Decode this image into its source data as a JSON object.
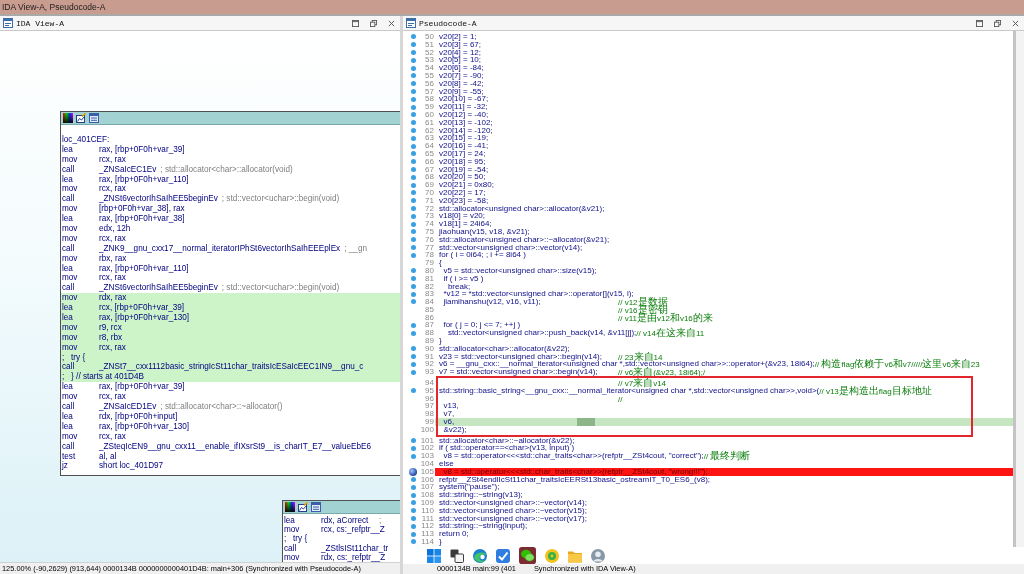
{
  "window": {
    "title": "IDA View-A, Pseudocode-A"
  },
  "ida_view": {
    "title": "IDA View-A",
    "nodes": [
      {
        "lines": [
          {
            "kind": "label",
            "text": "loc_401CEF:",
            "highlighted": false
          },
          {
            "kind": "instruction",
            "mnemonic": "lea",
            "operands": "rax, [rbp+0F0h+var_39]",
            "highlighted": false
          },
          {
            "kind": "instruction",
            "mnemonic": "mov",
            "operands": "rcx, rax",
            "highlighted": false
          },
          {
            "kind": "instruction",
            "mnemonic": "call",
            "operands": "_ZNSaIcEC1Ev",
            "comment": "; std::allocator<char>::allocator(void)",
            "highlighted": false
          },
          {
            "kind": "instruction",
            "mnemonic": "lea",
            "operands": "rax, [rbp+0F0h+var_110]",
            "highlighted": false
          },
          {
            "kind": "instruction",
            "mnemonic": "mov",
            "operands": "rcx, rax",
            "highlighted": false
          },
          {
            "kind": "instruction",
            "mnemonic": "call",
            "operands": "_ZNSt6vectorIhSaIhEE5beginEv",
            "comment": "; std::vector<uchar>::begin(void)",
            "highlighted": false
          },
          {
            "kind": "instruction",
            "mnemonic": "mov",
            "operands": "[rbp+0F0h+var_38], rax",
            "highlighted": false
          },
          {
            "kind": "instruction",
            "mnemonic": "lea",
            "operands": "rax, [rbp+0F0h+var_38]",
            "highlighted": false
          },
          {
            "kind": "instruction",
            "mnemonic": "mov",
            "operands": "edx, 12h",
            "highlighted": false
          },
          {
            "kind": "instruction",
            "mnemonic": "mov",
            "operands": "rcx, rax",
            "highlighted": false
          },
          {
            "kind": "instruction",
            "mnemonic": "call",
            "operands": "_ZNK9__gnu_cxx17__normal_iteratorIPhSt6vectorIhSaIhEEEplEx",
            "comment": "; __gn",
            "highlighted": false
          },
          {
            "kind": "instruction",
            "mnemonic": "mov",
            "operands": "rbx, rax",
            "highlighted": false
          },
          {
            "kind": "instruction",
            "mnemonic": "lea",
            "operands": "rax, [rbp+0F0h+var_110]",
            "highlighted": false
          },
          {
            "kind": "instruction",
            "mnemonic": "mov",
            "operands": "rcx, rax",
            "highlighted": false
          },
          {
            "kind": "instruction",
            "mnemonic": "call",
            "operands": "_ZNSt6vectorIhSaIhEE5beginEv",
            "comment": "; std::vector<uchar>::begin(void)",
            "highlighted": false
          },
          {
            "kind": "instruction",
            "mnemonic": "mov",
            "operands": "rdx, rax",
            "highlighted": true
          },
          {
            "kind": "instruction",
            "mnemonic": "lea",
            "operands": "rcx, [rbp+0F0h+var_39]",
            "highlighted": true
          },
          {
            "kind": "instruction",
            "mnemonic": "lea",
            "operands": "rax, [rbp+0F0h+var_130]",
            "highlighted": true
          },
          {
            "kind": "instruction",
            "mnemonic": "mov",
            "operands": "r9, rcx",
            "highlighted": true
          },
          {
            "kind": "instruction",
            "mnemonic": "mov",
            "operands": "r8, rbx",
            "highlighted": true
          },
          {
            "kind": "instruction",
            "mnemonic": "mov",
            "operands": "rcx, rax",
            "highlighted": true
          },
          {
            "kind": "directive",
            "text": ";   try {",
            "highlighted": true
          },
          {
            "kind": "instruction",
            "mnemonic": "call",
            "operands": "_ZNSt7__cxx1112basic_stringIcSt11char_traitsIcESaIcEEC1IN9__gnu_c",
            "highlighted": true
          },
          {
            "kind": "directive",
            "text": ";   } // starts at 401D4B",
            "highlighted": true
          },
          {
            "kind": "instruction",
            "mnemonic": "lea",
            "operands": "rax, [rbp+0F0h+var_39]",
            "highlighted": false
          },
          {
            "kind": "instruction",
            "mnemonic": "mov",
            "operands": "rcx, rax",
            "highlighted": false
          },
          {
            "kind": "instruction",
            "mnemonic": "call",
            "operands": "_ZNSaIcED1Ev",
            "comment": "; std::allocator<char>::~allocator()",
            "highlighted": false
          },
          {
            "kind": "instruction",
            "mnemonic": "lea",
            "operands": "rdx, [rbp+0F0h+input]",
            "highlighted": false
          },
          {
            "kind": "instruction",
            "mnemonic": "lea",
            "operands": "rax, [rbp+0F0h+var_130]",
            "highlighted": false
          },
          {
            "kind": "instruction",
            "mnemonic": "mov",
            "operands": "rcx, rax",
            "highlighted": false
          },
          {
            "kind": "instruction",
            "mnemonic": "call",
            "operands": "_ZSteqIcEN9__gnu_cxx11__enable_ifIXsrSt9__is_charIT_E7__valueEbE6",
            "highlighted": false
          },
          {
            "kind": "instruction",
            "mnemonic": "test",
            "operands": "al, al",
            "highlighted": false
          },
          {
            "kind": "instruction",
            "mnemonic": "jz",
            "operands": "short loc_401D97",
            "highlighted": false
          }
        ]
      },
      {
        "lines": [
          {
            "kind": "instruction",
            "mnemonic": "lea",
            "operands": "rdx, aCorrect",
            "comment": ";",
            "highlighted": false
          },
          {
            "kind": "instruction",
            "mnemonic": "mov",
            "operands": "rcx, cs:_refptr__Z",
            "highlighted": false
          },
          {
            "kind": "directive",
            "text": ";   try {",
            "highlighted": false
          },
          {
            "kind": "instruction",
            "mnemonic": "call",
            "operands": "_ZStlsISt11char_tr",
            "highlighted": false
          },
          {
            "kind": "instruction",
            "mnemonic": "mov",
            "operands": "rdx, cs:_refptr__Z",
            "highlighted": false
          }
        ]
      }
    ],
    "status_bar": "125.00% (-90,2629) (913,644) 0000134B 0000000000401D4B: main+306 (Synchronized with Pseudocode-A)"
  },
  "pseudocode": {
    "title": "Pseudocode-A",
    "blocks": [
      {
        "kind": "plain",
        "lines": [
          {
            "number": "50",
            "code": "v20[2] = 1;",
            "dot": true,
            "selected": false,
            "breakpoint": false
          },
          {
            "number": "51",
            "code": "v20[3] = 67;",
            "dot": true,
            "selected": false,
            "breakpoint": false
          },
          {
            "number": "52",
            "code": "v20[4] = 12;",
            "dot": true,
            "selected": false,
            "breakpoint": false
          },
          {
            "number": "53",
            "code": "v20[5] = 10;",
            "dot": true,
            "selected": false,
            "breakpoint": false
          },
          {
            "number": "54",
            "code": "v20[6] = -84;",
            "dot": true,
            "selected": false,
            "breakpoint": false
          },
          {
            "number": "55",
            "code": "v20[7] = -90;",
            "dot": true,
            "selected": false,
            "breakpoint": false
          },
          {
            "number": "56",
            "code": "v20[8] = -42;",
            "dot": true,
            "selected": false,
            "breakpoint": false
          },
          {
            "number": "57",
            "code": "v20[9] = -55;",
            "dot": true,
            "selected": false,
            "breakpoint": false
          },
          {
            "number": "58",
            "code": "v20[10] = -67;",
            "dot": true,
            "selected": false,
            "breakpoint": false
          },
          {
            "number": "59",
            "code": "v20[11] = -32;",
            "dot": true,
            "selected": false,
            "breakpoint": false
          },
          {
            "number": "60",
            "code": "v20[12] = -40;",
            "dot": true,
            "selected": false,
            "breakpoint": false
          },
          {
            "number": "61",
            "code": "v20[13] = -102;",
            "dot": true,
            "selected": false,
            "breakpoint": false
          },
          {
            "number": "62",
            "code": "v20[14] = -120;",
            "dot": true,
            "selected": false,
            "breakpoint": false
          },
          {
            "number": "63",
            "code": "v20[15] = -19;",
            "dot": true,
            "selected": false,
            "breakpoint": false
          },
          {
            "number": "64",
            "code": "v20[16] = -41;",
            "dot": true,
            "selected": false,
            "breakpoint": false
          },
          {
            "number": "65",
            "code": "v20[17] = 24;",
            "dot": true,
            "selected": false,
            "breakpoint": false
          },
          {
            "number": "66",
            "code": "v20[18] = 95;",
            "dot": true,
            "selected": false,
            "breakpoint": false
          },
          {
            "number": "67",
            "code": "v20[19] = -54;",
            "dot": true,
            "selected": false,
            "breakpoint": false
          },
          {
            "number": "68",
            "code": "v20[20] = 50;",
            "dot": true,
            "selected": false,
            "breakpoint": false
          },
          {
            "number": "69",
            "code": "v20[21] = 0x80;",
            "dot": true,
            "selected": false,
            "breakpoint": false
          },
          {
            "number": "70",
            "code": "v20[22] = 17;",
            "dot": true,
            "selected": false,
            "breakpoint": false
          },
          {
            "number": "71",
            "code": "v20[23] = -58;",
            "dot": true,
            "selected": false,
            "breakpoint": false
          },
          {
            "number": "72",
            "code": "std::allocator<unsigned char>::allocator(&v21);",
            "dot": true,
            "selected": false,
            "breakpoint": false
          },
          {
            "number": "73",
            "code": "v18[0] = v20;",
            "dot": true,
            "selected": false,
            "breakpoint": false
          },
          {
            "number": "74",
            "code": "v18[1] = 24i64;",
            "dot": true,
            "selected": false,
            "breakpoint": false
          },
          {
            "number": "75",
            "code": "jiaohuan(v15, v18, &v21);",
            "dot": true,
            "selected": false,
            "breakpoint": false
          },
          {
            "number": "76",
            "code": "std::allocator<unsigned char>::~allocator(&v21);",
            "dot": true,
            "selected": false,
            "breakpoint": false
          },
          {
            "number": "77",
            "code": "std::vector<unsigned char>::vector(v14);",
            "dot": true,
            "selected": false,
            "breakpoint": false
          },
          {
            "number": "78",
            "code": "for ( i = 0i64; ; i += 8i64 )",
            "dot": true,
            "selected": false,
            "breakpoint": false
          },
          {
            "number": "79",
            "code": "{",
            "dot": false,
            "selected": false,
            "breakpoint": false
          },
          {
            "number": "80",
            "code": "  v5 = std::vector<unsigned char>::size(v15);",
            "dot": true,
            "selected": false,
            "breakpoint": false
          },
          {
            "number": "81",
            "code": "  if ( i >= v5 )",
            "dot": true,
            "selected": false,
            "breakpoint": false
          },
          {
            "number": "82",
            "code": "    break;",
            "dot": true,
            "selected": false,
            "breakpoint": false
          },
          {
            "number": "83",
            "code": "  *v12 = *std::vector<unsigned char>::operator[](v15, i);",
            "dot": true,
            "selected": false,
            "breakpoint": false
          },
          {
            "number": "84",
            "code": "  jiamihanshu(v12, v16, v11);",
            "comment": "// v12是数据",
            "dot": true,
            "selected": false,
            "breakpoint": false
          },
          {
            "number": "85",
            "comment": "// v16是密钥",
            "dot": false,
            "selected": false,
            "breakpoint": false
          },
          {
            "number": "86",
            "comment": "// v11是由v12和v16的来",
            "dot": false,
            "selected": false,
            "breakpoint": false
          },
          {
            "number": "87",
            "code": "  for ( j = 0; j <= 7; ++j )",
            "dot": true,
            "selected": false,
            "breakpoint": false
          },
          {
            "number": "88",
            "code": "    std::vector<unsigned char>::push_back(v14, &v11[j]);",
            "comment": "// v14在这来自11",
            "dot": true,
            "selected": false,
            "breakpoint": false
          },
          {
            "number": "89",
            "code": "}",
            "dot": false,
            "selected": false,
            "breakpoint": false
          },
          {
            "number": "90",
            "code": "std::allocator<char>::allocator(&v22);",
            "dot": true,
            "selected": false,
            "breakpoint": false
          },
          {
            "number": "91",
            "code": "v23 = std::vector<unsigned char>::begin(v14);",
            "comment": "// 23来自14",
            "dot": true,
            "selected": false,
            "breakpoint": false
          },
          {
            "number": "92",
            "code": "v6 = __gnu_cxx::__normal_iterator<unsigned char *,std::vector<unsigned char>>::operator+(&v23, 18i64);",
            "comment": "// 构造flag依赖于v6和v7/////这里v6来自23",
            "dot": true,
            "selected": false,
            "breakpoint": false
          },
          {
            "number": "93",
            "code": "v7 = std::vector<unsigned char>::begin(v14);",
            "comment": "// v6来自(&v23, 18i64);/",
            "dot": true,
            "selected": false,
            "breakpoint": false
          }
        ]
      },
      {
        "kind": "annotated",
        "lines": [
          {
            "number": "94",
            "comment": "// v7来自v14",
            "dot": false,
            "selected": false,
            "breakpoint": false
          },
          {
            "number": "95",
            "code": "std::string::basic_string<__gnu_cxx::__normal_iterator<unsigned char *,std::vector<unsigned char>>,void>(",
            "comment": "// v13是构造出flag目标地址",
            "dot": true,
            "selected": false,
            "breakpoint": false
          },
          {
            "number": "96",
            "comment": "//",
            "dot": false,
            "selected": false,
            "breakpoint": false
          },
          {
            "number": "97",
            "code": "  v13,",
            "dot": false,
            "selected": false,
            "breakpoint": false
          },
          {
            "number": "98",
            "code": "  v7,",
            "dot": false,
            "selected": false,
            "breakpoint": false
          },
          {
            "number": "99",
            "code": "  v6,",
            "dot": false,
            "selected": true,
            "breakpoint": false
          },
          {
            "number": "100",
            "code": "  &v22);",
            "dot": false,
            "selected": false,
            "breakpoint": false
          }
        ]
      },
      {
        "kind": "plain",
        "lines": [
          {
            "number": "101",
            "code": "std::allocator<char>::~allocator(&v22);",
            "dot": true,
            "selected": false,
            "breakpoint": false
          },
          {
            "number": "102",
            "code": "if ( std::operator==<char>(v13, input) )",
            "dot": true,
            "selected": false,
            "breakpoint": false
          },
          {
            "number": "103",
            "code": "  v8 = std::operator<<<std::char_traits<char>>(refptr__ZSt4cout, \"correct\");",
            "comment": "// 最终判断",
            "dot": true,
            "selected": false,
            "breakpoint": false
          },
          {
            "number": "104",
            "code": "else",
            "dot": false,
            "selected": false,
            "breakpoint": false
          },
          {
            "number": "105",
            "code": "  v8 = std::operator<<<std::char_traits<char>>(refptr__ZSt4cout, \"wrong!!!\");",
            "dot": true,
            "selected": false,
            "breakpoint": true
          },
          {
            "number": "106",
            "code": "refptr__ZSt4endlIcSt11char_traitsIcEERSt13basic_ostreamIT_T0_ES6_(v8);",
            "dot": true,
            "selected": false,
            "breakpoint": false
          },
          {
            "number": "107",
            "code": "system(\"pause\");",
            "dot": true,
            "selected": false,
            "breakpoint": false
          },
          {
            "number": "108",
            "code": "std::string::~string(v13);",
            "dot": true,
            "selected": false,
            "breakpoint": false
          },
          {
            "number": "109",
            "code": "std::vector<unsigned char>::~vector(v14);",
            "dot": true,
            "selected": false,
            "breakpoint": false
          },
          {
            "number": "110",
            "code": "std::vector<unsigned char>::~vector(v15);",
            "dot": true,
            "selected": false,
            "breakpoint": false
          },
          {
            "number": "111",
            "code": "std::vector<unsigned char>::~vector(v17);",
            "dot": true,
            "selected": false,
            "breakpoint": false
          },
          {
            "number": "112",
            "code": "std::string::~string(input);",
            "dot": true,
            "selected": false,
            "breakpoint": false
          },
          {
            "number": "113",
            "code": "return 0;",
            "dot": true,
            "selected": false,
            "breakpoint": false
          },
          {
            "number": "114",
            "code": "}",
            "dot": true,
            "selected": false,
            "breakpoint": false
          }
        ]
      }
    ],
    "status_bar": [
      "0000134B main:99 (401",
      "Synchronized with IDA View-A)"
    ]
  },
  "taskbar": {
    "apps": [
      {
        "kind": "start",
        "selected": false
      },
      {
        "kind": "task_view",
        "selected": false
      },
      {
        "kind": "swirl",
        "selected": false
      },
      {
        "kind": "check_tile",
        "selected": false
      },
      {
        "kind": "chat",
        "selected": true
      },
      {
        "kind": "disc",
        "selected": false
      },
      {
        "kind": "folder",
        "selected": false
      },
      {
        "kind": "avatar",
        "selected": false
      }
    ]
  }
}
